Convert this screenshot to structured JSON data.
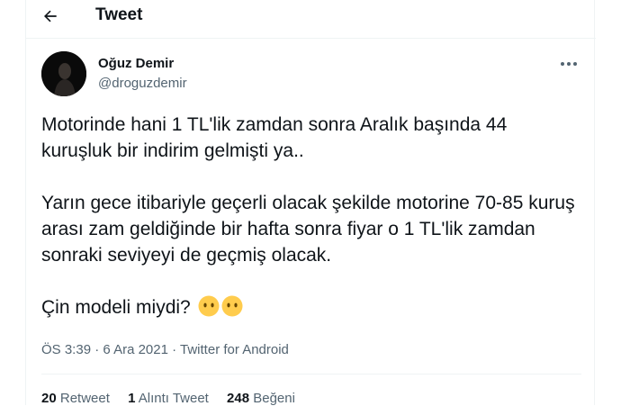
{
  "header": {
    "title": "Tweet"
  },
  "author": {
    "name": "Oğuz Demir",
    "handle": "@droguzdemir"
  },
  "tweet": {
    "line1": "Motorinde hani 1 TL'lik zamdan sonra Aralık başında 44 kuruşluk bir indirim gelmişti ya..",
    "line2": "Yarın gece itibariyle geçerli olacak şekilde motorine 70-85 kuruş arası zam geldiğinde bir hafta sonra fiyar o 1 TL'lik zamdan sonraki seviyeyi de geçmiş olacak.",
    "line3": "Çin modeli miydi?"
  },
  "meta": {
    "time": "ÖS 3:39",
    "sep1": " · ",
    "date": "6 Ara 2021",
    "sep2": " · ",
    "source": "Twitter for Android"
  },
  "stats": {
    "retweets_count": "20",
    "retweets_label": "Retweet",
    "quotes_count": "1",
    "quotes_label": "Alıntı Tweet",
    "likes_count": "248",
    "likes_label": "Beğeni"
  },
  "icons": {
    "back": "arrow-left-icon",
    "more": "more-horizontal-icon",
    "emoji": "face-without-mouth-icon"
  },
  "colors": {
    "text": "#0f1419",
    "secondary": "#536471",
    "border": "#eff3f4",
    "emoji": "#ffcc4d"
  }
}
